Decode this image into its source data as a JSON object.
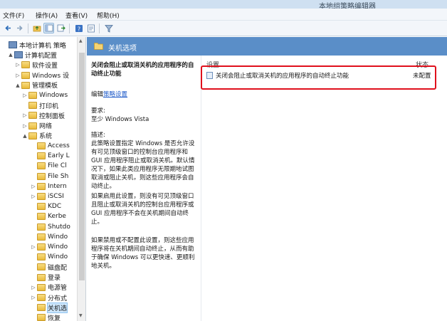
{
  "window": {
    "title": "本地组策略编辑器"
  },
  "menu": [
    "文件(F)",
    "操作(A)",
    "查看(V)",
    "帮助(H)"
  ],
  "toolbar": [
    "back-arrow-icon",
    "forward-arrow-icon",
    "up-folder-icon",
    "show-tree-icon",
    "export-icon",
    "help-icon",
    "properties-icon",
    "filter-icon"
  ],
  "tree": {
    "items": [
      {
        "label": "本地计算机 策略",
        "icon": "computer-policy-icon",
        "arrow": ""
      },
      {
        "label": "计算机配置",
        "icon": "computer-icon",
        "arrow": "▲"
      },
      {
        "label": "软件设置",
        "icon": "folder-icon",
        "arrow": "▷"
      },
      {
        "label": "Windows 设",
        "icon": "folder-icon",
        "arrow": "▷"
      },
      {
        "label": "管理模板",
        "icon": "folder-icon",
        "arrow": "▲"
      },
      {
        "label": "Windows",
        "icon": "folder-icon",
        "arrow": "▷"
      },
      {
        "label": "打印机",
        "icon": "folder-icon",
        "arrow": ""
      },
      {
        "label": "控制面板",
        "icon": "folder-icon",
        "arrow": "▷"
      },
      {
        "label": "网络",
        "icon": "folder-icon",
        "arrow": "▷"
      },
      {
        "label": "系统",
        "icon": "folder-icon",
        "arrow": "▲"
      },
      {
        "label": "Access",
        "icon": "folder-icon",
        "arrow": ""
      },
      {
        "label": "Early L",
        "icon": "folder-icon",
        "arrow": ""
      },
      {
        "label": "File Cl",
        "icon": "folder-icon",
        "arrow": ""
      },
      {
        "label": "File Sh",
        "icon": "folder-icon",
        "arrow": ""
      },
      {
        "label": "Intern",
        "icon": "folder-icon",
        "arrow": "▷"
      },
      {
        "label": "iSCSI",
        "icon": "folder-icon",
        "arrow": "▷"
      },
      {
        "label": "KDC",
        "icon": "folder-icon",
        "arrow": ""
      },
      {
        "label": "Kerbe",
        "icon": "folder-icon",
        "arrow": ""
      },
      {
        "label": "Shutdo",
        "icon": "folder-icon",
        "arrow": ""
      },
      {
        "label": "Windo",
        "icon": "folder-icon",
        "arrow": ""
      },
      {
        "label": "Windo",
        "icon": "folder-icon",
        "arrow": "▷"
      },
      {
        "label": "Windo",
        "icon": "folder-icon",
        "arrow": ""
      },
      {
        "label": "磁盘配",
        "icon": "folder-icon",
        "arrow": ""
      },
      {
        "label": "登录",
        "icon": "folder-icon",
        "arrow": ""
      },
      {
        "label": "电源管",
        "icon": "folder-icon",
        "arrow": "▷"
      },
      {
        "label": "分布式",
        "icon": "folder-icon",
        "arrow": "▷"
      },
      {
        "label": "关机选",
        "icon": "folder-icon",
        "arrow": "",
        "selected": true
      },
      {
        "label": "恢复",
        "icon": "folder-icon",
        "arrow": ""
      }
    ]
  },
  "header": {
    "title": "关机选项"
  },
  "description": {
    "title": "关闭会阻止或取消关机的应用程序的自动终止功能",
    "edit_prefix": "编辑",
    "edit_link": "策略设置",
    "requirements_label": "要求:",
    "requirements_value": "至少 Windows Vista",
    "desc_label": "描述:",
    "desc_p1": "此策略设置指定 Windows 是否允许没有可见顶级窗口的控制台应用程序和 GUI 应用程序阻止或取消关机。默认情况下，如果此类应用程序无限期地试图取消或阻止关机，则这些应用程序会自动终止。",
    "desc_p2": "如果启用此设置，则没有可见顶级窗口且阻止或取消关机的控制台应用程序或 GUI 应用程序不会在关机期间自动终止。",
    "desc_p3": "如果禁用或不配置此设置，则这些应用程序将在关机期间自动终止，从而有助于确保 Windows 可以更快速、更顺利地关机。"
  },
  "list": {
    "col_setting": "设置",
    "col_state": "状态",
    "rows": [
      {
        "name": "关闭会阻止或取消关机的应用程序的自动终止功能",
        "state": "未配置"
      }
    ]
  },
  "colors": {
    "header_band": "#5a8ec8",
    "highlight": "#e0101c",
    "link": "#1d59c8"
  }
}
